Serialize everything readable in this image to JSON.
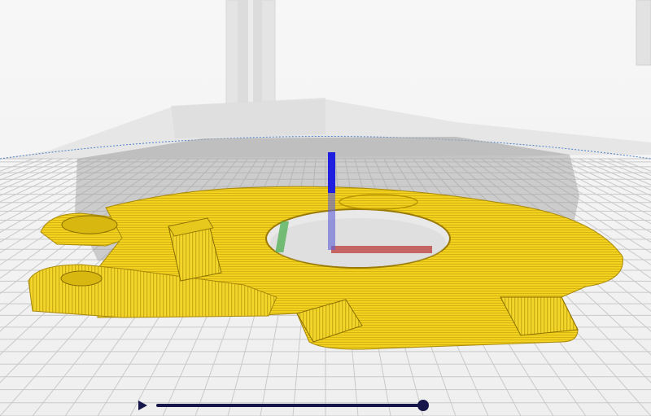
{
  "app": {
    "view": "layer-preview",
    "toolpath_color": "#f2d21f",
    "toolpath_edge_color": "#8a6e00",
    "build_plate_color": "#eeeeee",
    "grid_color": "#c9c9c9",
    "axis_colors": {
      "x": "#c0504d",
      "y": "#4caf50",
      "z": "#1f1fe0"
    }
  },
  "icons": {
    "play": "play-icon",
    "handle": "slider-handle-icon"
  },
  "layer_slider": {
    "accent_color": "#16164a",
    "position": 1.0
  }
}
